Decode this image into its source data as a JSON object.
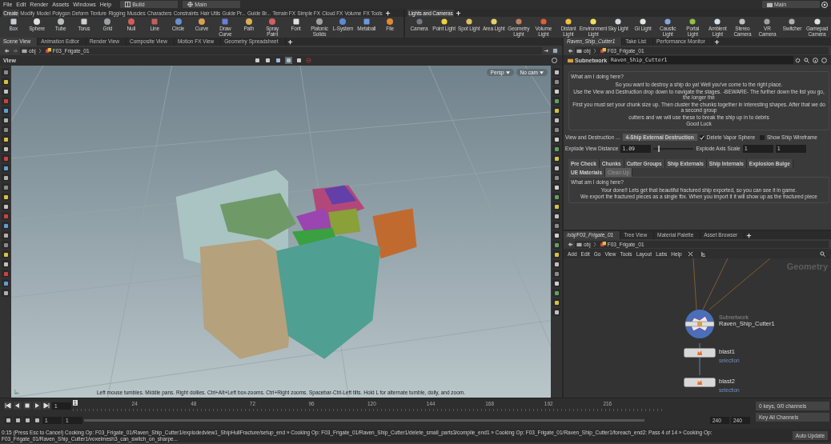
{
  "menubar": {
    "menus": [
      "File",
      "Edit",
      "Render",
      "Assets",
      "Windows",
      "Help"
    ],
    "desktop": "Build",
    "context": "Main",
    "right_context": "Main"
  },
  "shelf_left": {
    "tabs": [
      {
        "label": "Create",
        "selected": true
      },
      {
        "label": "Modify",
        "selected": false
      },
      {
        "label": "Model",
        "selected": false
      },
      {
        "label": "Polygon",
        "selected": false
      },
      {
        "label": "Deform",
        "selected": false
      },
      {
        "label": "Texture",
        "selected": false
      },
      {
        "label": "Rigging",
        "selected": false
      },
      {
        "label": "Muscles",
        "selected": false
      },
      {
        "label": "Characters",
        "selected": false
      },
      {
        "label": "Constraints",
        "selected": false
      },
      {
        "label": "Hair Utils",
        "selected": false
      },
      {
        "label": "Guide Pr...",
        "selected": false
      },
      {
        "label": "Guide Br...",
        "selected": false
      },
      {
        "label": "Terrain FX",
        "selected": false
      },
      {
        "label": "Simple FX",
        "selected": false
      },
      {
        "label": "Cloud FX",
        "selected": false
      },
      {
        "label": "Volume",
        "selected": false
      },
      {
        "label": "FX Tools",
        "selected": false
      }
    ],
    "tools": [
      "Box",
      "Sphere",
      "Tube",
      "Torus",
      "Grid",
      "Null",
      "Line",
      "Circle",
      "Curve",
      "Draw Curve",
      "Path",
      "Spray Paint",
      "Font",
      "Platonic Solids",
      "L-System",
      "Metaball",
      "File"
    ]
  },
  "shelf_right": {
    "tabs": [
      {
        "label": "Lights and Cameras",
        "selected": true
      }
    ],
    "tools": [
      "Camera",
      "Point Light",
      "Spot Light",
      "Area Light",
      "Geometry Light",
      "Volume Light",
      "Distant Light",
      "Environment Light",
      "Sky Light",
      "GI Light",
      "Caustic Light",
      "Portal Light",
      "Ambient Light",
      "Stereo Camera",
      "VR Camera",
      "Switcher",
      "Gamepad Camera"
    ]
  },
  "scene_pane": {
    "tabs": [
      {
        "label": "Scene View",
        "selected": true
      },
      {
        "label": "Animation Editor",
        "selected": false
      },
      {
        "label": "Render View",
        "selected": false
      },
      {
        "label": "Composite View",
        "selected": false
      },
      {
        "label": "Motion FX View",
        "selected": false
      },
      {
        "label": "Geometry Spreadsheet",
        "selected": false
      }
    ],
    "path": [
      "obj",
      "F03_Frigate_01"
    ],
    "viewport": {
      "title": "View",
      "camera_buttons": [
        "Persp",
        "No cam"
      ],
      "hint": "Left mouse tumbles. Middle pans. Right dollies. Ctrl+Alt+Left box-zooms. Ctrl+Right zooms. Spacebar-Ctrl-Left tilts. Hold L for alternate tumble, dolly, and zoom."
    }
  },
  "parameter_pane": {
    "tabs": [
      {
        "label": "Raven_Ship_Cutter1",
        "selected": true
      },
      {
        "label": "Take List",
        "selected": false
      },
      {
        "label": "Performance Monitor",
        "selected": false
      }
    ],
    "path": [
      "obj",
      "F03_Frigate_01"
    ],
    "node_type": "Subnetwork",
    "node_name": "Raven_Ship_Cutter1",
    "intro": {
      "title": "What am I doing here?",
      "lines": [
        "So you want to destroy a ship do ya! Well you've come to the right place.",
        "Use the View and Destruction drop down to navigate the stages. -BEWARE- The further down the list you go, the longer the",
        "First you must set your chunk size up. Then cluster the chunks together in interesting shapes. After that we do a second group",
        "cutters and we will use these to break the ship up in to debris",
        "Good Luck"
      ]
    },
    "stage_label": "View and Destruction ...",
    "stage_value": "4-Ship External Destruction",
    "checkboxes": [
      {
        "label": "Delete Vapor Sphere",
        "checked": true
      },
      {
        "label": "Show Ship Wireframe",
        "checked": false
      }
    ],
    "distance_label": "Explode View Distance",
    "distance_value": "1.09",
    "distance_slider": {
      "level": 0.12
    },
    "axis_label": "Explode Axis Scale",
    "axis_values": [
      "1",
      "1"
    ],
    "tabs2": [
      {
        "label": "Pre Check",
        "selected": false
      },
      {
        "label": "Chunks",
        "selected": false
      },
      {
        "label": "Cutter Groups",
        "selected": false
      },
      {
        "label": "Ship Externals",
        "selected": false
      },
      {
        "label": "Ship Internals",
        "selected": false
      },
      {
        "label": "Explosion Bulge",
        "selected": false
      },
      {
        "label": "UE Materials",
        "selected": false
      },
      {
        "label": "Clean Up",
        "selected": true
      }
    ],
    "outro": {
      "title": "What am I doing here?",
      "lines": [
        "Your done!! Lets get that beautiful fractured ship exported, so you can see it in game.",
        "We export the fractured pieces as a single fbx. When you import it it will show up as the fractured piece"
      ]
    }
  },
  "network_pane": {
    "tabs": [
      {
        "label": "/obj/F03_Frigate_01",
        "selected": true
      },
      {
        "label": "Tree View",
        "selected": false
      },
      {
        "label": "Material Palette",
        "selected": false
      },
      {
        "label": "Asset Browser",
        "selected": false
      }
    ],
    "path": [
      "obj",
      "F03_Frigate_01"
    ],
    "menus": [
      "Add",
      "Edit",
      "Go",
      "View",
      "Tools",
      "Layout",
      "Labs",
      "Help"
    ],
    "context_label": "Geometry",
    "nodes": [
      {
        "kind": "subnet",
        "type": "Subnetwork",
        "name": "Raven_Ship_Cutter1"
      },
      {
        "kind": "sop",
        "name": "blast1",
        "comment": "selection"
      },
      {
        "kind": "sop",
        "name": "blast2",
        "comment": "selection"
      }
    ]
  },
  "timeline": {
    "frame": "1",
    "ticks": [
      "24",
      "48",
      "72",
      "96",
      "120",
      "144",
      "168",
      "192",
      "216"
    ],
    "current": "1",
    "range_start": [
      "1",
      "1"
    ],
    "range_end": [
      "240",
      "240"
    ],
    "keys": "0 keys, 0/0 channels",
    "key_button": "Key All Channels"
  },
  "status_bar": {
    "message": "0:15 (Press Esc to Cancel) Cooking Op: F03_Frigate_01/Raven_Ship_Cutter1/explodedview1_ShipHullFracture/setup_end » Cooking Op: F03_Frigate_01/Raven_Ship_Cutter1/delete_small_parts3/compile_end1 » Cooking Op: F03_Frigate_01/Raven_Ship_Cutter1/foreach_end2: Pass 4 of 14 » Cooking Op: F03_Frigate_01/Raven_Ship_Cutter1/voxelmesh3_can_switch_on_sharpe...",
    "update_button": "Auto Update"
  }
}
